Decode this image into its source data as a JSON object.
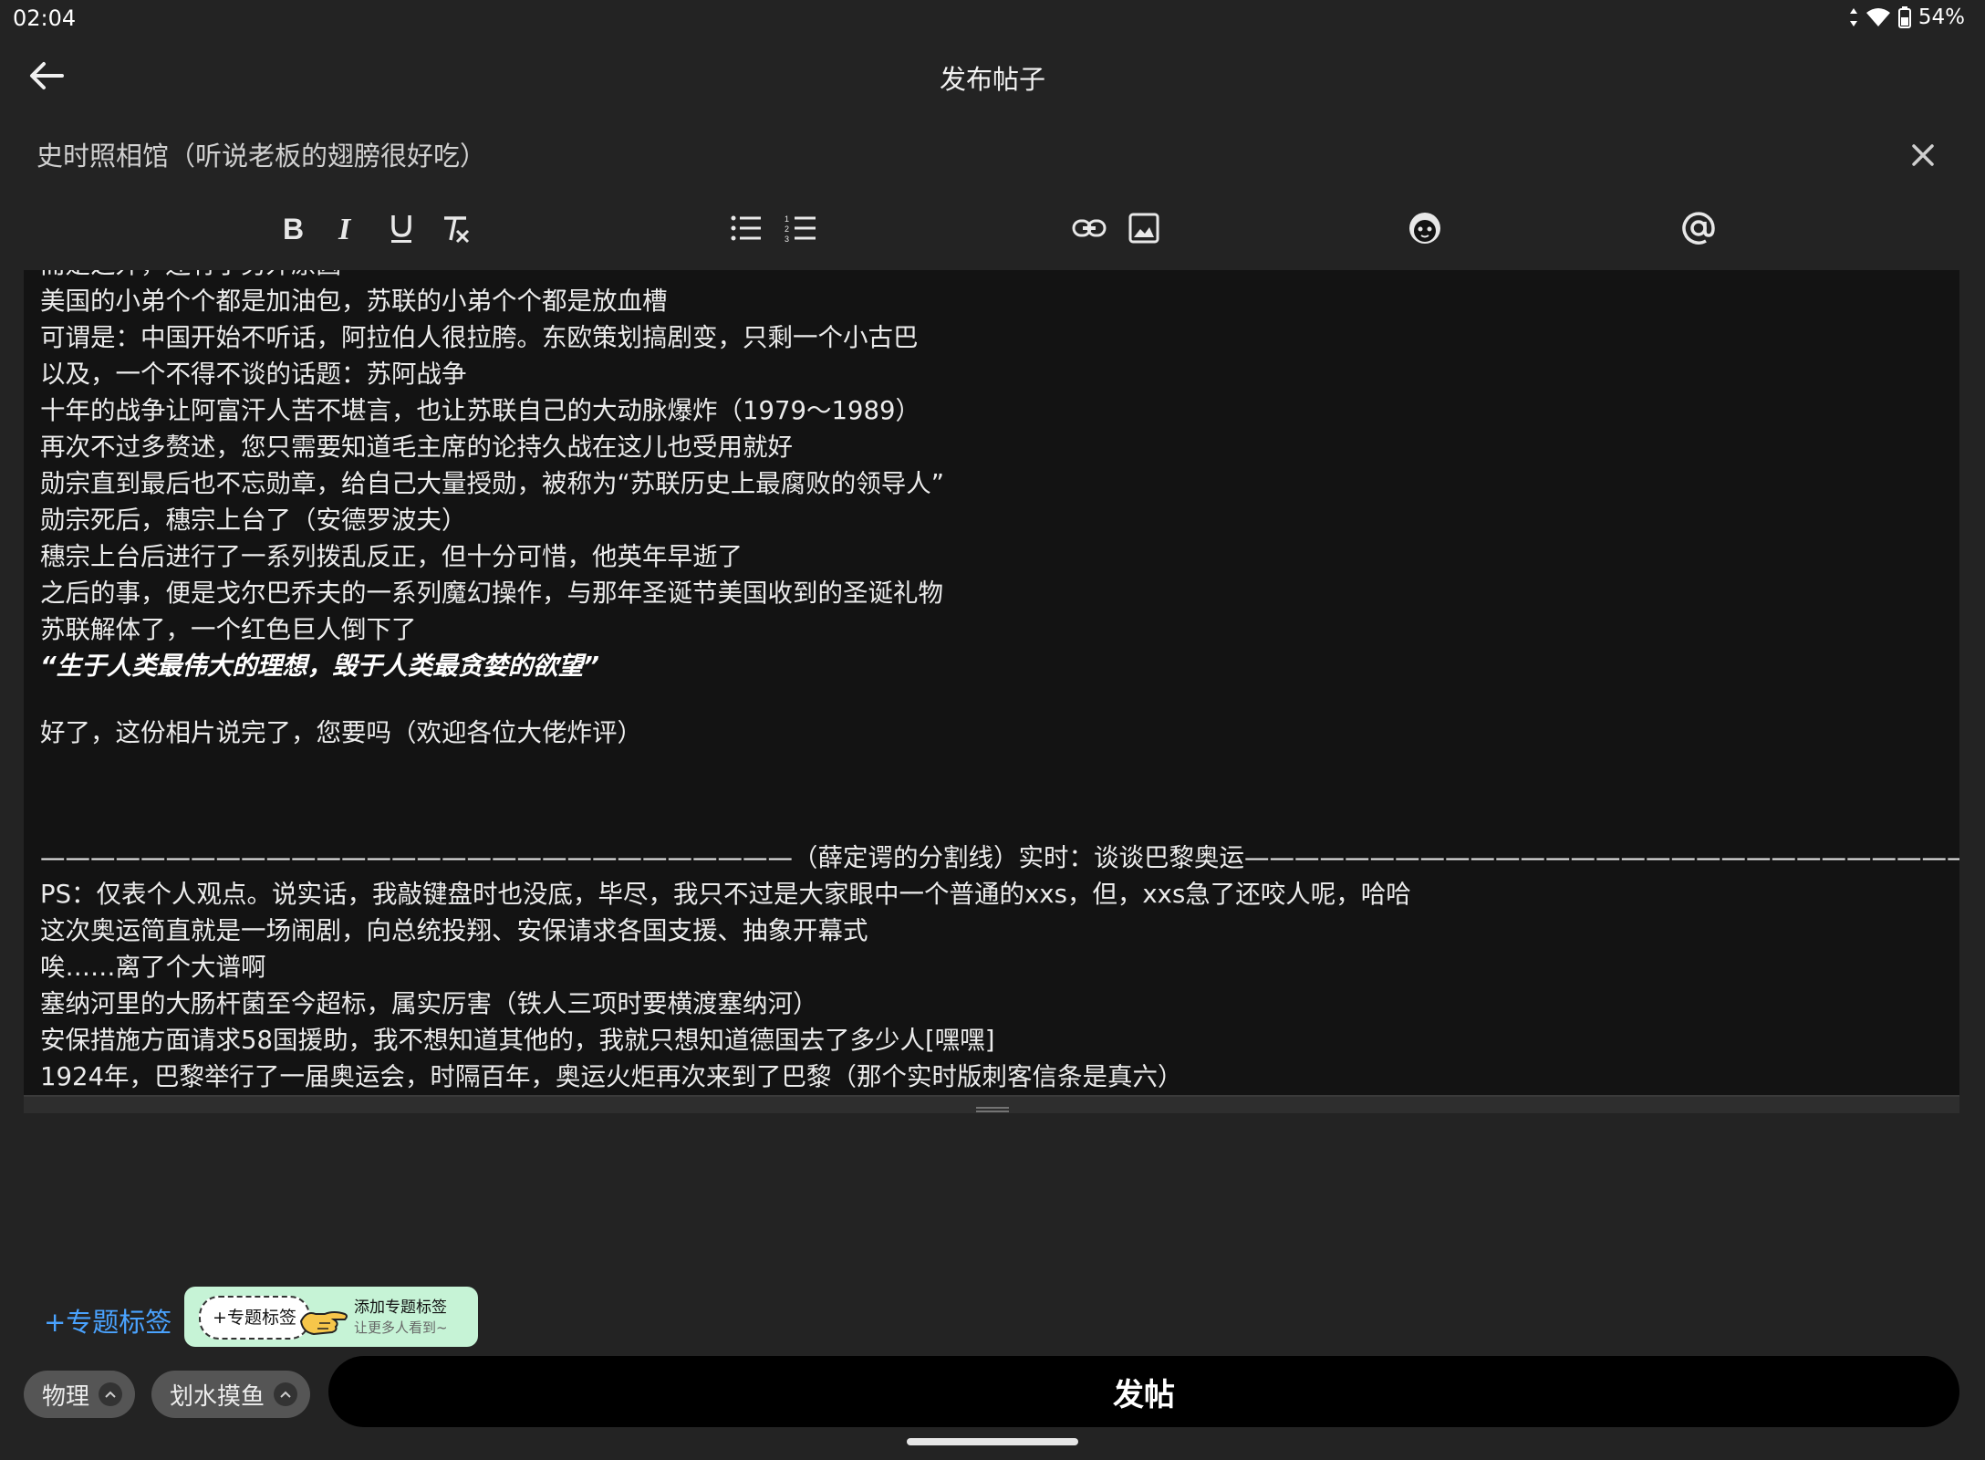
{
  "status": {
    "time": "02:04",
    "battery": "54%"
  },
  "header": {
    "title": "发布帖子"
  },
  "post_title": {
    "value": "史时照相馆（听说老板的翅膀很好吃）"
  },
  "toolbar": {
    "buttons": [
      "bold-icon",
      "italic-icon",
      "underline-icon",
      "clear-format-icon",
      "bullet-list-icon",
      "numbered-list-icon",
      "link-icon",
      "image-icon",
      "emoji-icon",
      "mention-icon"
    ]
  },
  "editor": {
    "lines": [
      "而是之外，还有了另外原因",
      "美国的小弟个个都是加油包，苏联的小弟个个都是放血槽",
      "可谓是：中国开始不听话，阿拉伯人很拉胯。东欧策划搞剧变，只剩一个小古巴",
      "以及，一个不得不谈的话题：苏阿战争",
      "十年的战争让阿富汗人苦不堪言，也让苏联自己的大动脉爆炸（1979～1989）",
      "再次不过多赘述，您只需要知道毛主席的论持久战在这儿也受用就好",
      "勋宗直到最后也不忘勋章，给自己大量授勋，被称为“苏联历史上最腐败的领导人”",
      "勋宗死后，穗宗上台了（安德罗波夫）",
      "穗宗上台后进行了一系列拨乱反正，但十分可惜，他英年早逝了",
      "之后的事，便是戈尔巴乔夫的一系列魔幻操作，与那年圣诞节美国收到的圣诞礼物",
      "苏联解体了，一个红色巨人倒下了"
    ],
    "quote": "“生于人类最伟大的理想，毁于人类最贪婪的欲望”",
    "closing": "好了，这份相片说完了，您要吗（欢迎各位大佬炸评）",
    "divider": "——————————————————————————————（薛定谔的分割线）实时：谈谈巴黎奥运————————————————————————————————————",
    "lines2": [
      "PS：仅表个人观点。说实话，我敲键盘时也没底，毕尽，我只不过是大家眼中一个普通的xxs，但，xxs急了还咬人呢，哈哈",
      "这次奥运简直就是一场闹剧，向总统投翔、安保请求各国支援、抽象开幕式",
      "唉……离了个大谱啊",
      "塞纳河里的大肠杆菌至今超标，属实厉害（铁人三项时要横渡塞纳河）",
      "安保措施方面请求58国援助，我不想知道其他的，我就只想知道德国去了多少人[嘿嘿]",
      "1924年，巴黎举行了一届奥运会，时隔百年，奥运火炬再次来到了巴黎（那个实时版刺客信条是真六）"
    ]
  },
  "topic": {
    "link": "+专题标签",
    "hint_badge": "+专题标签",
    "hint_title": "添加专题标签",
    "hint_sub": "让更多人看到~"
  },
  "tags": [
    {
      "label": "物理"
    },
    {
      "label": "划水摸鱼"
    }
  ],
  "post_button": "发帖",
  "colors": {
    "accent": "#4aa3ff",
    "hint_bg": "#c6f3d6"
  }
}
